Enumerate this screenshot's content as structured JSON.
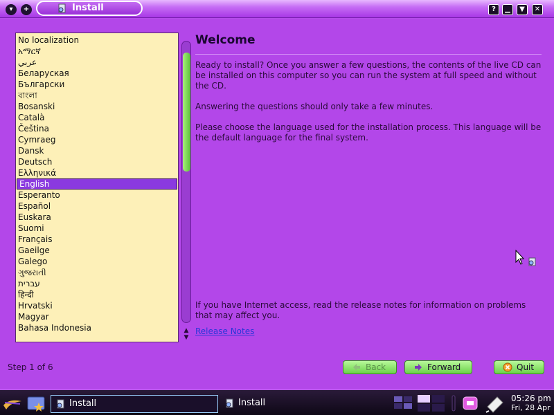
{
  "window": {
    "title": "Install"
  },
  "languages": [
    "No localization",
    "አማርኛ",
    "عربي",
    "Беларуская",
    "Български",
    "বাংলা",
    "Bosanski",
    "Català",
    "Čeština",
    "Cymraeg",
    "Dansk",
    "Deutsch",
    "Ελληνικά",
    "English",
    "Esperanto",
    "Español",
    "Euskara",
    "Suomi",
    "Français",
    "Gaeilge",
    "Galego",
    "ગુજરાતી",
    "עברית",
    "हिन्दी",
    "Hrvatski",
    "Magyar",
    "Bahasa Indonesia"
  ],
  "selected_language": "English",
  "main": {
    "heading": "Welcome",
    "para1": "Ready to install? Once you answer a few questions, the contents of the live CD can be installed on this computer so you can run the system at full speed and without the CD.",
    "para2": "Answering the questions should only take a few minutes.",
    "para3": "Please choose the language used for the installation process. This language will be the default language for the final system.",
    "para4": "If you have Internet access, read the release notes for information on problems that may affect you.",
    "release_link": "Release Notes"
  },
  "footer": {
    "step": "Step 1 of 6",
    "back_label": "Back",
    "forward_label": "Forward",
    "quit_label": "Quit"
  },
  "taskbar": {
    "task1": "Install",
    "task2": "Install",
    "time": "05:26 pm",
    "date": "Fri, 28 Apr"
  },
  "colors": {
    "accent": "#b347e9",
    "list_bg": "#fdf0b8",
    "selection": "#8a39e0",
    "button": "#8be46a"
  }
}
